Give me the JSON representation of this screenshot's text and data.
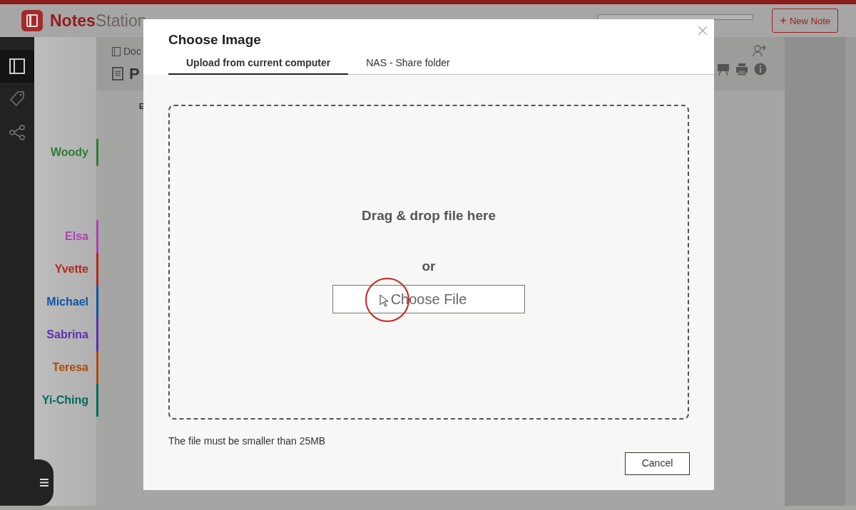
{
  "topbar": {
    "logo_bold": "Notes",
    "logo_rest": "Station",
    "new_note_plus": "+",
    "new_note_label": "New Note"
  },
  "note": {
    "breadcrumb": "Doc",
    "title": "P",
    "editor_letter": "E"
  },
  "people_groups": [
    [
      {
        "name": "Woody",
        "color": "#2e7d32"
      }
    ],
    [
      {
        "name": "Elsa",
        "color": "#b03fb0"
      },
      {
        "name": "Yvette",
        "color": "#b3261e"
      },
      {
        "name": "Michael",
        "color": "#0d55a8"
      },
      {
        "name": "Sabrina",
        "color": "#5a2fb8"
      },
      {
        "name": "Teresa",
        "color": "#b04a00"
      },
      {
        "name": "Yi-Ching",
        "color": "#00695c"
      }
    ]
  ],
  "dialog": {
    "title": "Choose Image",
    "tabs": [
      {
        "label": "Upload from current computer",
        "selected": true
      },
      {
        "label": "NAS - Share folder",
        "selected": false
      }
    ],
    "drop_text": "Drag & drop file here",
    "or_text": "or",
    "choose_button": "Choose File",
    "size_note": "The file must be smaller than 25MB",
    "cancel_button": "Cancel"
  }
}
